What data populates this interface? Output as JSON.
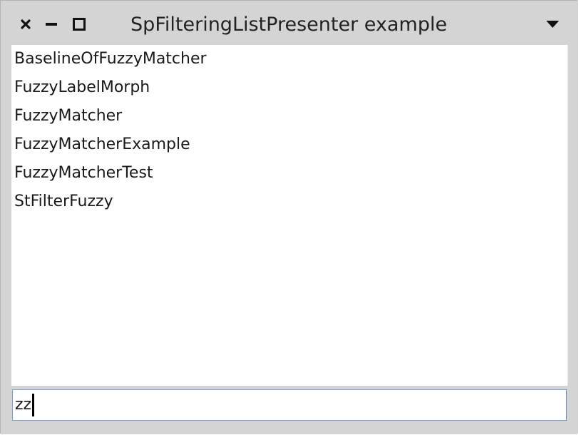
{
  "window": {
    "title": "SpFilteringListPresenter example"
  },
  "titlebar": {
    "close_icon": "close-icon",
    "minimize_icon": "minimize-icon",
    "maximize_icon": "maximize-icon",
    "menu_icon": "chevron-down-icon"
  },
  "list": {
    "items": [
      {
        "label": "BaselineOfFuzzyMatcher"
      },
      {
        "label": "FuzzyLabelMorph"
      },
      {
        "label": "FuzzyMatcher"
      },
      {
        "label": "FuzzyMatcherExample"
      },
      {
        "label": "FuzzyMatcherTest"
      },
      {
        "label": "StFilterFuzzy"
      }
    ]
  },
  "filter": {
    "value": "zz"
  },
  "colors": {
    "chrome": "#d4d4d4",
    "list_background": "#ffffff",
    "focus_border": "#7a9fd6",
    "text": "#1a1a1a"
  }
}
